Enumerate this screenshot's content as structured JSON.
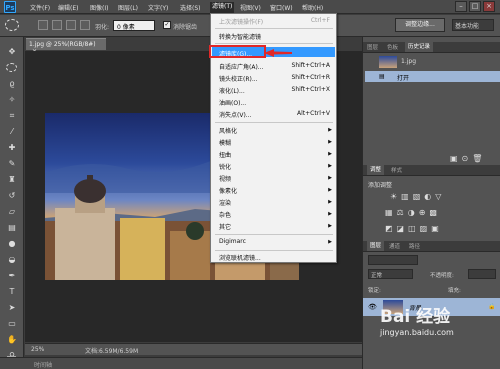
{
  "app": {
    "logo": "Ps"
  },
  "menubar": {
    "items": [
      "文件(F)",
      "编辑(E)",
      "图像(I)",
      "图层(L)",
      "文字(Y)",
      "选择(S)",
      "滤镜(T)",
      "视图(V)",
      "窗口(W)",
      "帮助(H)"
    ],
    "active_index": 6
  },
  "options": {
    "feather_label": "羽化:",
    "feather_value": "0 像素",
    "antialias_label": "消除锯齿",
    "adjust_edge": "调整边缘...",
    "workspace": "基本功能"
  },
  "document": {
    "tab_label": "1.jpg @ 25%(RGB/8#)",
    "close_glyph": "×",
    "zoom": "25%",
    "doc_info": "文档:6.59M/6.59M",
    "timeline_label": "时间轴"
  },
  "filter_menu": {
    "items": [
      {
        "label": "上次滤镜操作(F)",
        "shortcut": "Ctrl+F",
        "disabled": true
      },
      {
        "label": "转换为智能滤镜",
        "shortcut": "",
        "disabled": false
      },
      {
        "label": "滤镜库(G)...",
        "shortcut": "",
        "highlighted": true
      },
      {
        "label": "自适应广角(A)...",
        "shortcut": "Shift+Ctrl+A"
      },
      {
        "label": "镜头校正(R)...",
        "shortcut": "Shift+Ctrl+R"
      },
      {
        "label": "液化(L)...",
        "shortcut": "Shift+Ctrl+X"
      },
      {
        "label": "油画(O)...",
        "shortcut": ""
      },
      {
        "label": "消失点(V)...",
        "shortcut": "Alt+Ctrl+V"
      },
      {
        "label": "风格化",
        "submenu": true
      },
      {
        "label": "模糊",
        "submenu": true
      },
      {
        "label": "扭曲",
        "submenu": true
      },
      {
        "label": "锐化",
        "submenu": true
      },
      {
        "label": "视频",
        "submenu": true
      },
      {
        "label": "像素化",
        "submenu": true
      },
      {
        "label": "渲染",
        "submenu": true
      },
      {
        "label": "杂色",
        "submenu": true
      },
      {
        "label": "其它",
        "submenu": true
      },
      {
        "label": "Digimarc",
        "submenu": true
      },
      {
        "label": "浏览联机滤镜...",
        "shortcut": ""
      }
    ]
  },
  "history_panel": {
    "tabs": [
      "图层",
      "色板",
      "历史记录"
    ],
    "snapshot": "1.jpg",
    "state": "打开"
  },
  "adjust_panel": {
    "tabs": [
      "调整",
      "样式"
    ],
    "title": "添加调整"
  },
  "layers_panel": {
    "tabs": [
      "图层",
      "通道",
      "路径"
    ],
    "kind": "正常",
    "opacity_label": "不透明度:",
    "lock_label": "锁定:",
    "fill_label": "填充:",
    "layer_name": "背景"
  },
  "watermark": {
    "brand": "Bai 经验",
    "url": "jingyan.baidu.com"
  },
  "colors": {
    "highlight": "#3399ff",
    "red_marker": "#e02828",
    "panel_bg": "#535353"
  }
}
